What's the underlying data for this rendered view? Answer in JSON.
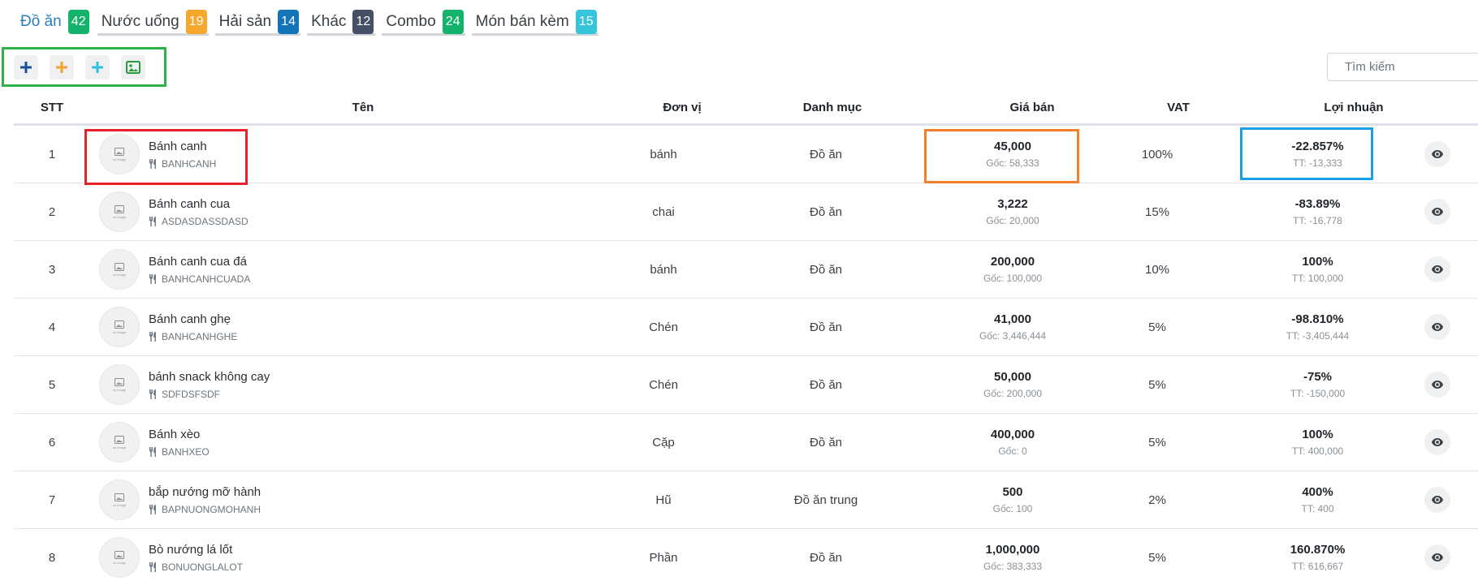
{
  "colors": {
    "red_box": "#e8202a",
    "orange_box": "#f47f2a",
    "blue_box": "#1aa0e6",
    "green_box": "#2fb24a"
  },
  "tabs": [
    {
      "label": "Đồ ăn",
      "count": "42",
      "color": "#14b36b",
      "active": true
    },
    {
      "label": "Nước uống",
      "count": "19",
      "color": "#f6a82b",
      "active": false
    },
    {
      "label": "Hải sản",
      "count": "14",
      "color": "#1374b8",
      "active": false
    },
    {
      "label": "Khác",
      "count": "12",
      "color": "#454f66",
      "active": false
    },
    {
      "label": "Combo",
      "count": "24",
      "color": "#14b36b",
      "active": false
    },
    {
      "label": "Món bán kèm",
      "count": "15",
      "color": "#35c6dc",
      "active": false
    }
  ],
  "toolbar": {
    "buttons": [
      {
        "icon": "plus-icon",
        "color": "#1c4f9a"
      },
      {
        "icon": "plus-icon",
        "color": "#f6a033"
      },
      {
        "icon": "plus-icon",
        "color": "#35c0dc"
      },
      {
        "icon": "image-icon",
        "color": "#2b9a3a"
      }
    ]
  },
  "search": {
    "placeholder": "Tìm kiếm"
  },
  "table": {
    "headers": {
      "stt": "STT",
      "name": "Tên",
      "unit": "Đơn vị",
      "category": "Danh mục",
      "price": "Giá bán",
      "vat": "VAT",
      "profit": "Lợi nhuận"
    },
    "thumb_text": "no image",
    "rows": [
      {
        "stt": "1",
        "name": "Bánh canh",
        "code": "BANHCANH",
        "unit": "bánh",
        "category": "Đồ ăn",
        "price": "45,000",
        "cost": "Gốc: 58,333",
        "vat": "100%",
        "profit": "-22.857%",
        "tt": "TT: -13,333"
      },
      {
        "stt": "2",
        "name": "Bánh canh cua",
        "code": "ASDASDASSDASD",
        "unit": "chai",
        "category": "Đồ ăn",
        "price": "3,222",
        "cost": "Gốc: 20,000",
        "vat": "15%",
        "profit": "-83.89%",
        "tt": "TT: -16,778"
      },
      {
        "stt": "3",
        "name": "Bánh canh cua đá",
        "code": "BANHCANHCUADA",
        "unit": "bánh",
        "category": "Đồ ăn",
        "price": "200,000",
        "cost": "Gốc: 100,000",
        "vat": "10%",
        "profit": "100%",
        "tt": "TT: 100,000"
      },
      {
        "stt": "4",
        "name": "Bánh canh ghẹ",
        "code": "BANHCANHGHE",
        "unit": "Chén",
        "category": "Đồ ăn",
        "price": "41,000",
        "cost": "Gốc: 3,446,444",
        "vat": "5%",
        "profit": "-98.810%",
        "tt": "TT: -3,405,444"
      },
      {
        "stt": "5",
        "name": "bánh snack không cay",
        "code": "SDFDSFSDF",
        "unit": "Chén",
        "category": "Đồ ăn",
        "price": "50,000",
        "cost": "Gốc: 200,000",
        "vat": "5%",
        "profit": "-75%",
        "tt": "TT: -150,000"
      },
      {
        "stt": "6",
        "name": "Bánh xèo",
        "code": "BANHXEO",
        "unit": "Cặp",
        "category": "Đồ ăn",
        "price": "400,000",
        "cost": "Gốc: 0",
        "vat": "5%",
        "profit": "100%",
        "tt": "TT: 400,000"
      },
      {
        "stt": "7",
        "name": "bắp nướng mỡ hành",
        "code": "BAPNUONGMOHANH",
        "unit": "Hũ",
        "category": "Đồ ăn trung",
        "price": "500",
        "cost": "Gốc: 100",
        "vat": "2%",
        "profit": "400%",
        "tt": "TT: 400"
      },
      {
        "stt": "8",
        "name": "Bò nướng lá lốt",
        "code": "BONUONGLALOT",
        "unit": "Phần",
        "category": "Đồ ăn",
        "price": "1,000,000",
        "cost": "Gốc: 383,333",
        "vat": "5%",
        "profit": "160.870%",
        "tt": "TT: 616,667"
      }
    ]
  }
}
